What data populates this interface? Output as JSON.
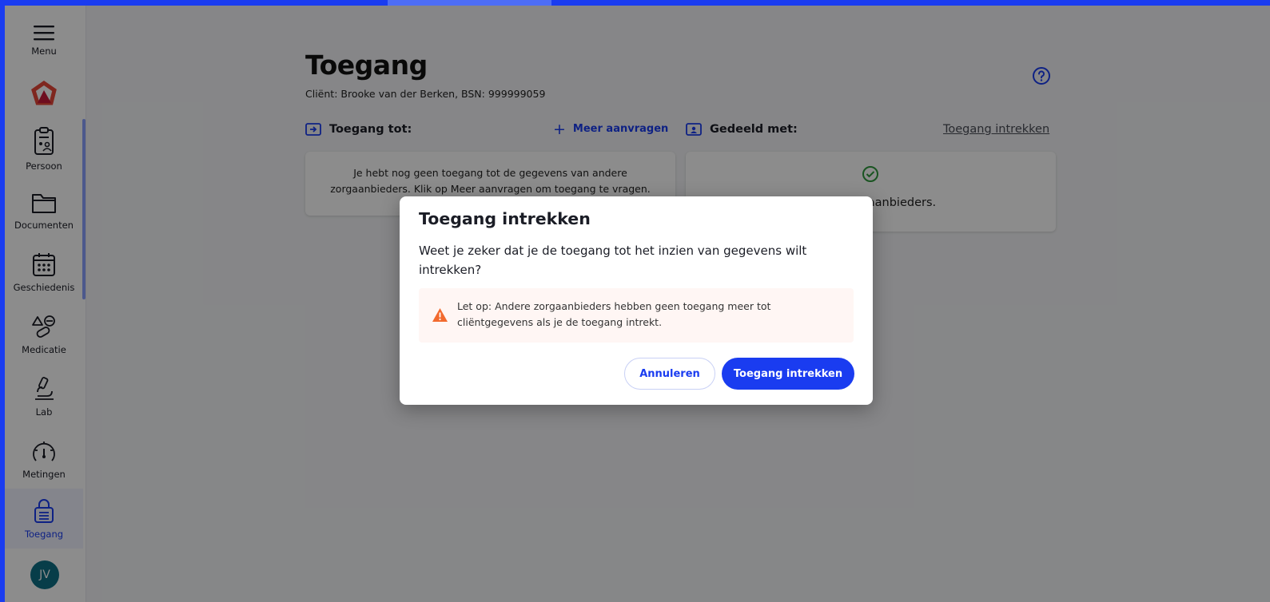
{
  "sidebar": {
    "menu_label": "Menu",
    "items": [
      {
        "label": "Persoon",
        "icon": "clipboard-person-icon"
      },
      {
        "label": "Documenten",
        "icon": "folder-icon"
      },
      {
        "label": "Geschiedenis",
        "icon": "calendar-icon"
      },
      {
        "label": "Medicatie",
        "icon": "medication-icon"
      },
      {
        "label": "Lab",
        "icon": "microscope-icon"
      },
      {
        "label": "Metingen",
        "icon": "gauge-icon"
      },
      {
        "label": "Toegang",
        "icon": "lock-icon",
        "active": true
      }
    ],
    "avatar_initials": "JV"
  },
  "page": {
    "title": "Toegang",
    "client_line": "Cliënt: Brooke van der Berken, BSN: 999999059"
  },
  "left_section": {
    "heading": "Toegang tot:",
    "action_label": "Meer aanvragen",
    "empty_text": "Je hebt nog geen toegang tot de gegevens van andere zorgaanbieders. Klik op Meer aanvragen om toegang te vragen."
  },
  "right_section": {
    "heading": "Gedeeld met:",
    "action_label": "Toegang intrekken",
    "text": "ndere zorgaanbieders."
  },
  "modal": {
    "title": "Toegang intrekken",
    "body": "Weet je zeker dat je de toegang tot het inzien van gegevens wilt intrekken?",
    "warning": "Let op: Andere zorgaanbieders hebben geen toegang meer tot cliëntgegevens als je de toegang intrekt.",
    "cancel_label": "Annuleren",
    "confirm_label": "Toegang intrekken"
  },
  "colors": {
    "accent": "#1a3cf0",
    "warning": "#f26a2e",
    "success": "#2e9a3c",
    "avatar": "#0d6f86"
  }
}
